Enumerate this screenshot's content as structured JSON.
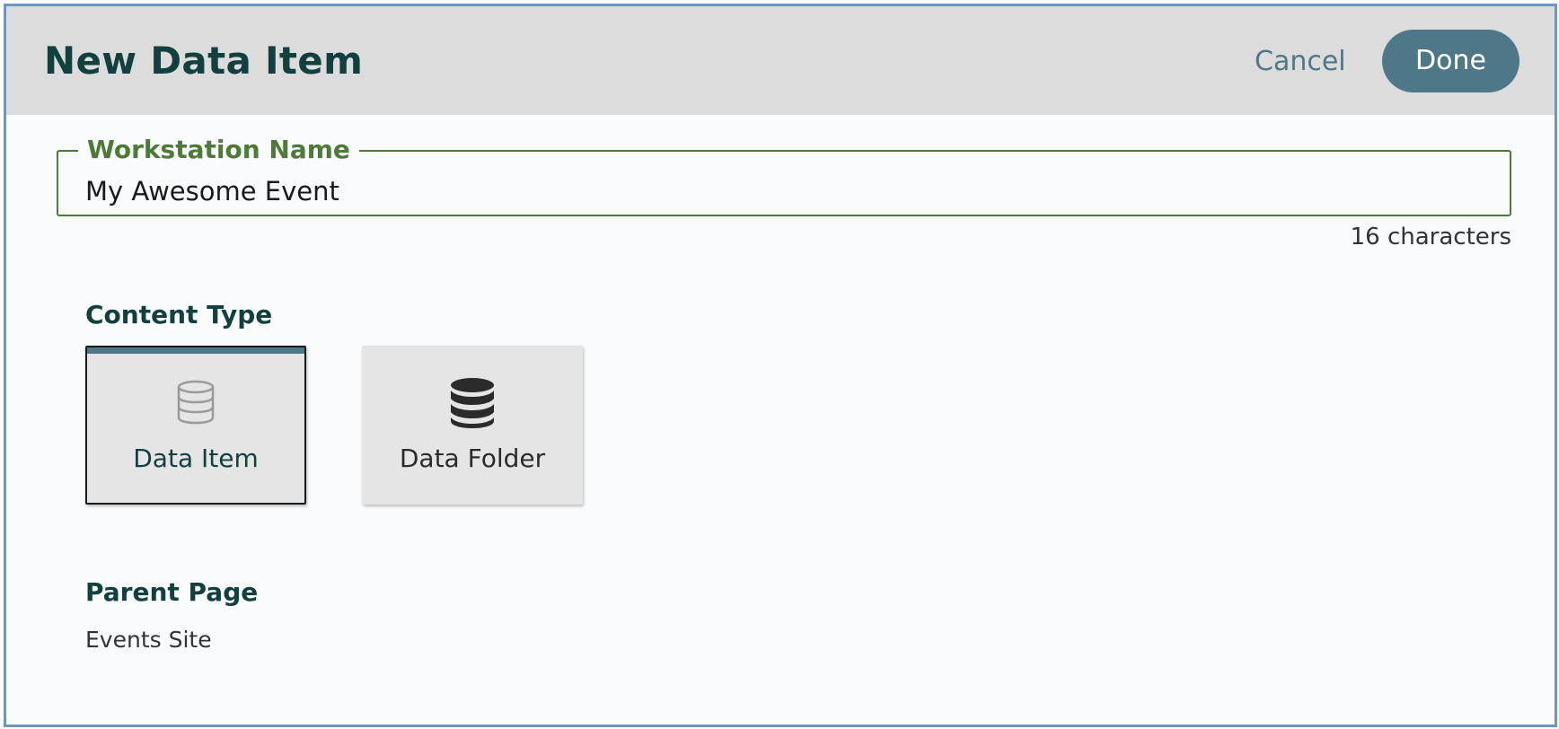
{
  "header": {
    "title": "New Data Item",
    "cancel_label": "Cancel",
    "done_label": "Done"
  },
  "name_field": {
    "label": "Workstation Name",
    "value": "My Awesome Event",
    "char_count": "16 characters"
  },
  "content_type": {
    "heading": "Content Type",
    "options": [
      {
        "label": "Data Item",
        "icon": "database-outline-icon",
        "selected": true
      },
      {
        "label": "Data Folder",
        "icon": "database-solid-icon",
        "selected": false
      }
    ]
  },
  "parent_page": {
    "heading": "Parent Page",
    "value": "Events Site"
  },
  "colors": {
    "accent": "#4e7887",
    "field_border": "#4e7a38",
    "heading": "#12403f",
    "header_bg": "#dcdcdc",
    "window_border": "#6e96c4"
  }
}
